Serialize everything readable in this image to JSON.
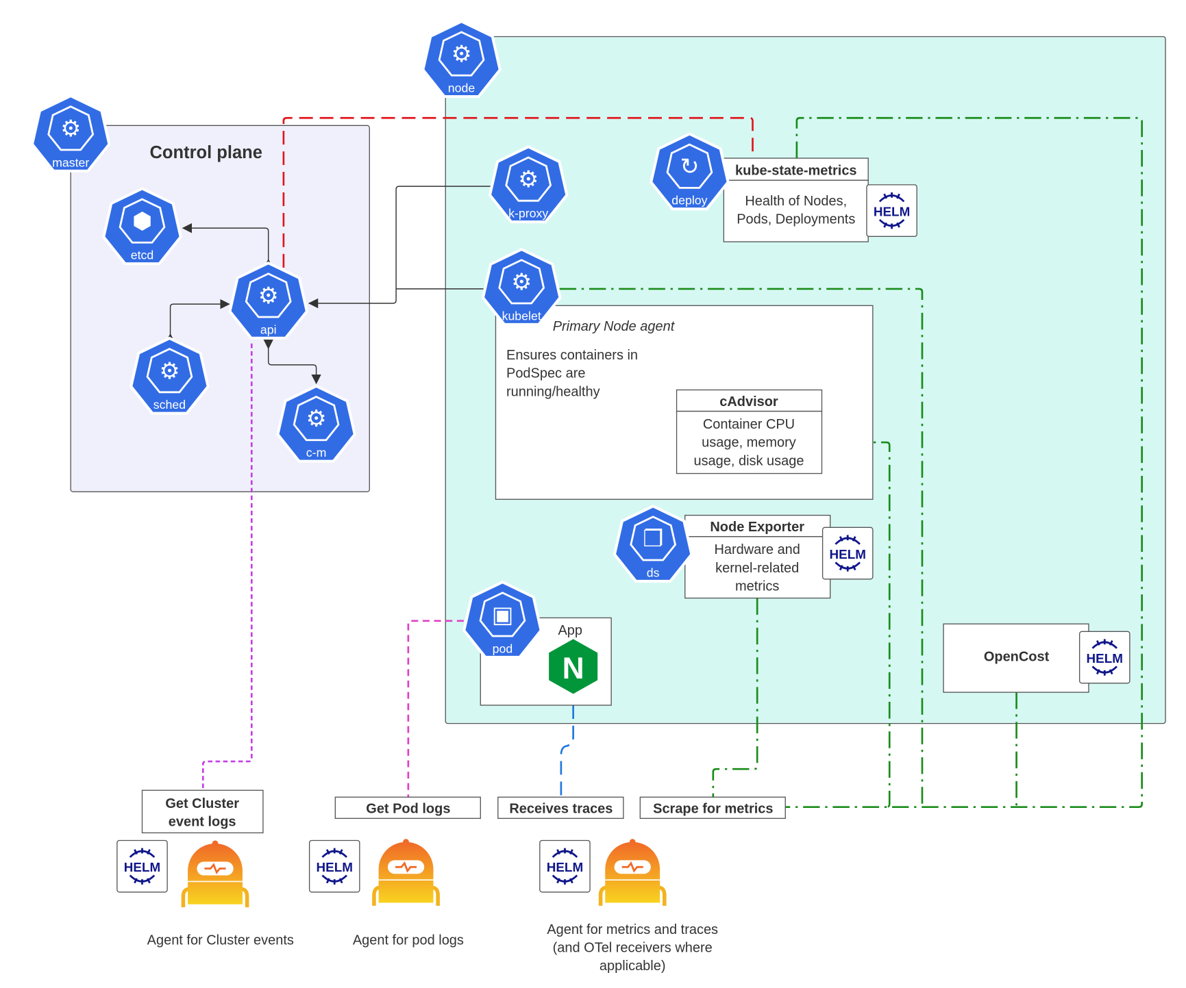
{
  "control_plane": {
    "title": "Control plane",
    "nodes": {
      "master": "master",
      "etcd": "etcd",
      "api": "api",
      "sched": "sched",
      "cm": "c-m"
    }
  },
  "node": {
    "label": "node",
    "kproxy": "k-proxy",
    "deploy": "deploy",
    "kubelet": "kubelet",
    "ds": "ds",
    "pod": "pod",
    "kube_state_metrics": {
      "title": "kube-state-metrics",
      "desc": [
        "Health of Nodes,",
        "Pods, Deployments"
      ]
    },
    "primary_agent": {
      "title": "Primary Node agent",
      "desc": [
        "Ensures containers in",
        "PodSpec are",
        "running/healthy"
      ]
    },
    "cadvisor": {
      "title": "cAdvisor",
      "desc": [
        "Container CPU",
        "usage, memory",
        "usage, disk usage"
      ]
    },
    "node_exporter": {
      "title": "Node Exporter",
      "desc": [
        "Hardware and",
        "kernel-related",
        "metrics"
      ]
    },
    "app": {
      "title": "App"
    },
    "opencost": {
      "title": "OpenCost"
    }
  },
  "helm_text": "HELM",
  "actions": {
    "cluster_events": [
      "Get Cluster",
      "event logs"
    ],
    "pod_logs": "Get Pod logs",
    "traces": "Receives traces",
    "metrics": "Scrape for metrics"
  },
  "agents": {
    "cluster": "Agent for Cluster events",
    "pod": "Agent for pod logs",
    "metrics": [
      "Agent for metrics and traces",
      "(and OTel receivers where",
      "applicable)"
    ]
  },
  "colors": {
    "k8s_blue": "#326ce5",
    "control_plane_bg": "#f0f0fc",
    "node_bg": "#d6f8f3",
    "red_line": "#e0161c",
    "green_line": "#1a8c1a",
    "purple_line": "#c23fe6",
    "magenta_line": "#e03fc4",
    "blue_line": "#1e78e0",
    "helm_navy": "#0f1689",
    "nginx_green": "#009639"
  }
}
